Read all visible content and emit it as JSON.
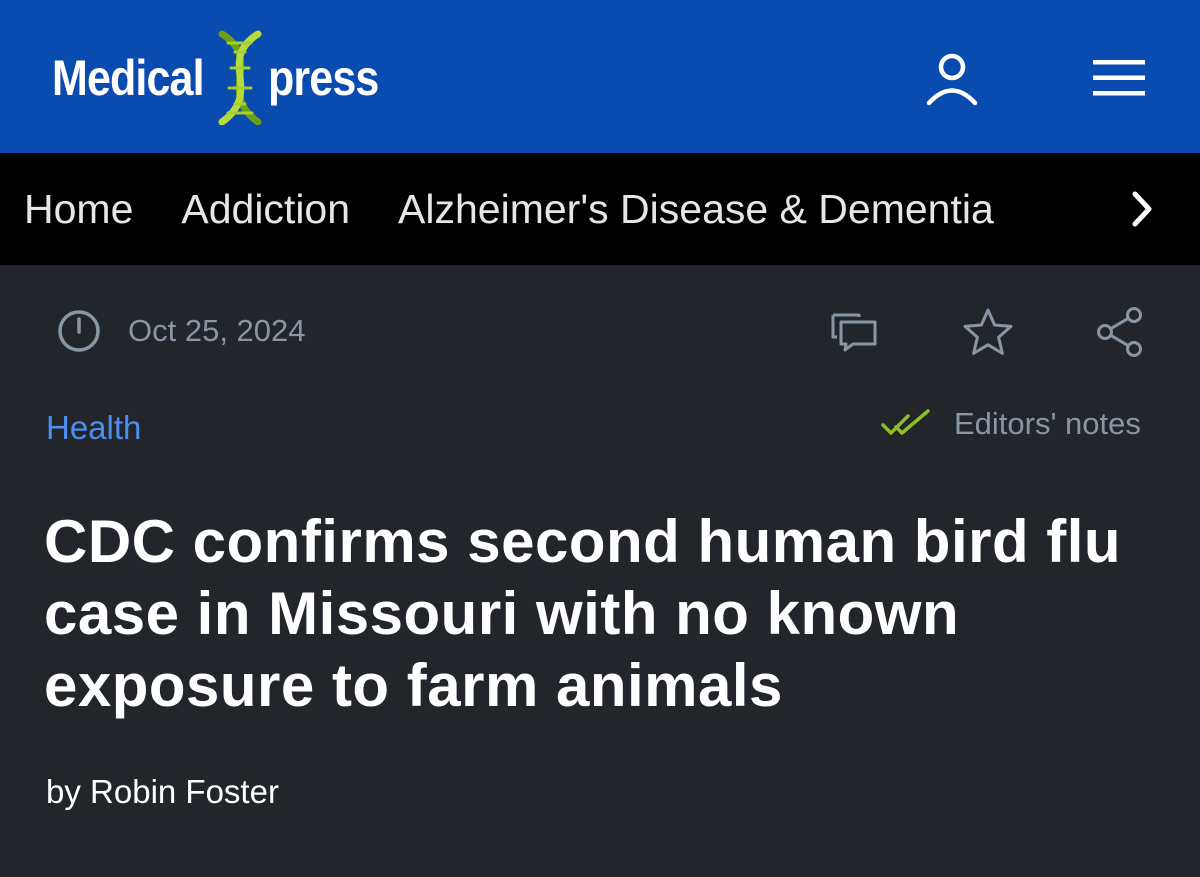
{
  "header": {
    "logo_left": "Medical",
    "logo_right": "press",
    "logo_icon": "dna-helix-icon",
    "user_icon": "user-icon",
    "menu_icon": "hamburger-menu-icon",
    "colors": {
      "background": "#0a4bb0",
      "dna_green": "#9ccc2a"
    }
  },
  "category_nav": {
    "items": [
      {
        "label": "Home"
      },
      {
        "label": "Addiction"
      },
      {
        "label": "Alzheimer's Disease & Dementia"
      }
    ],
    "next_icon": "chevron-right-icon"
  },
  "article": {
    "date": "Oct 25, 2024",
    "date_icon": "clock-icon",
    "actions": {
      "comment_icon": "comment-icon",
      "bookmark_icon": "star-icon",
      "share_icon": "share-icon"
    },
    "section": "Health",
    "editors_notes": "Editors' notes",
    "editors_icon": "double-check-icon",
    "title": "CDC confirms second human bird flu case in Missouri with no known exposure to farm animals",
    "byline_prefix": "by",
    "author": "Robin Foster",
    "colors": {
      "section_link": "#4d8ff0",
      "check_green": "#8cbf26"
    }
  }
}
